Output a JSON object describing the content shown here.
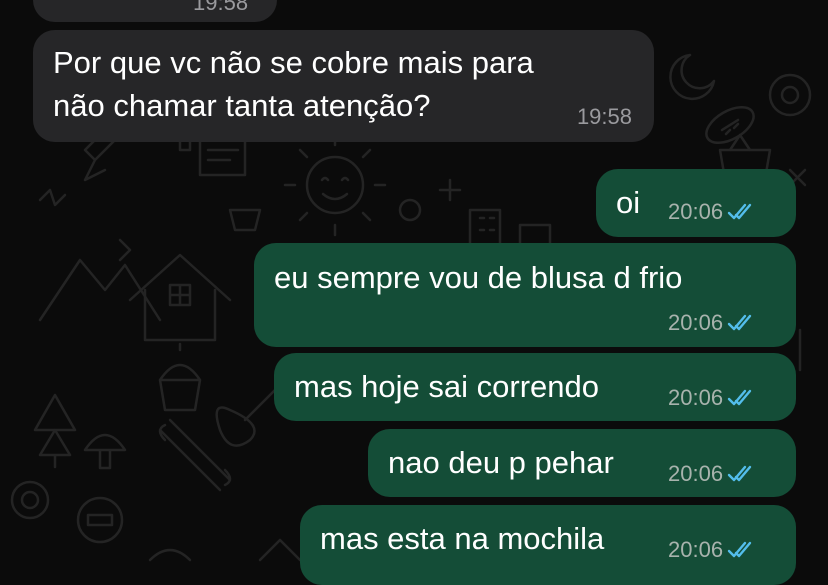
{
  "chat": {
    "messages": [
      {
        "direction": "in",
        "text": "19:58",
        "time": ""
      },
      {
        "direction": "in",
        "text_lines": [
          "Por que vc não se cobre mais para",
          "não chamar tanta atenção?"
        ],
        "time": "19:58"
      },
      {
        "direction": "out",
        "text": "oi",
        "time": "20:06",
        "status": "read"
      },
      {
        "direction": "out",
        "text": "eu sempre vou de blusa d frio",
        "time": "20:06",
        "status": "read"
      },
      {
        "direction": "out",
        "text": "mas hoje sai correndo",
        "time": "20:06",
        "status": "read"
      },
      {
        "direction": "out",
        "text": "nao deu p pehar",
        "time": "20:06",
        "status": "read"
      },
      {
        "direction": "out",
        "text": "mas esta na mochila",
        "time": "20:06",
        "status": "read"
      }
    ]
  },
  "colors": {
    "incoming_bubble": "#262628",
    "outgoing_bubble": "#144d37",
    "read_tick": "#53bdeb",
    "background": "#0b0b0b"
  },
  "icons": {
    "read_status": "double-check-icon"
  }
}
